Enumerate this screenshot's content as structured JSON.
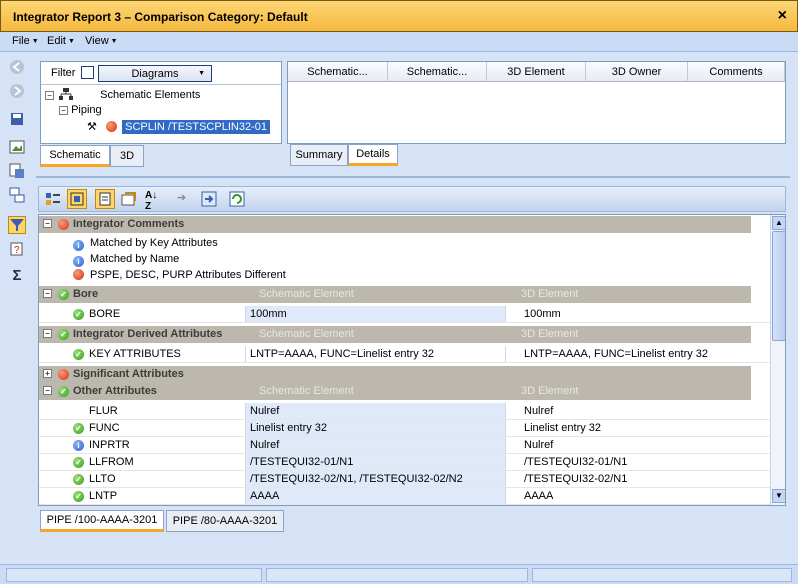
{
  "window": {
    "title": "Integrator Report 3 – Comparison Category: Default",
    "close": "×"
  },
  "menu": [
    {
      "label": "File"
    },
    {
      "label": "Edit"
    },
    {
      "label": "View"
    }
  ],
  "left_toolbar": [
    "back-icon",
    "forward-icon",
    "save-icon",
    "image-icon",
    "export-icon",
    "compare-icon",
    "filter-icon",
    "help-icon",
    "sum-icon"
  ],
  "filter": {
    "label": "Filter",
    "dropdown_value": "Diagrams"
  },
  "tree": {
    "root": "Schematic Elements",
    "child": "Piping",
    "leaf": "SCPLIN /TESTSCPLIN32-01"
  },
  "left_tabs": [
    "Schematic",
    "3D"
  ],
  "columns": [
    "Schematic...",
    "Schematic...",
    "3D Element",
    "3D Owner",
    "Comments"
  ],
  "right_tabs": [
    "Summary",
    "Details"
  ],
  "grid_toolbar": [
    "categorized-icon",
    "filter-icon",
    "properties-icon",
    "events-icon",
    "sort-icon",
    "next-icon",
    "export-icon",
    "refresh-icon"
  ],
  "grid": {
    "integrator_comments": {
      "label": "Integrator Comments",
      "items": [
        "Matched by Key Attributes",
        "Matched by Name",
        "PSPE, DESC, PURP Attributes Different"
      ]
    },
    "headers": {
      "schematic": "Schematic Element",
      "d3": "3D Element"
    },
    "bore": {
      "label": "Bore",
      "row": {
        "name": "BORE",
        "v1": "100mm",
        "v2": "100mm"
      }
    },
    "derived": {
      "label": "Integrator Derived Attributes",
      "row": {
        "name": "KEY ATTRIBUTES",
        "v1": "LNTP=AAAA, FUNC=Linelist entry 32",
        "v2": "LNTP=AAAA, FUNC=Linelist entry 32"
      }
    },
    "significant": {
      "label": "Significant Attributes"
    },
    "other": {
      "label": "Other Attributes",
      "rows": [
        {
          "name": "FLUR",
          "v1": "Nulref",
          "v2": "Nulref",
          "icon": "none"
        },
        {
          "name": "FUNC",
          "v1": "Linelist entry 32",
          "v2": "Linelist entry 32",
          "icon": "green"
        },
        {
          "name": "INPRTR",
          "v1": "Nulref",
          "v2": "Nulref",
          "icon": "blue"
        },
        {
          "name": "LLFROM",
          "v1": "/TESTEQUI32-01/N1",
          "v2": "/TESTEQUI32-01/N1",
          "icon": "green"
        },
        {
          "name": "LLTO",
          "v1": "/TESTEQUI32-02/N1, /TESTEQUI32-02/N2",
          "v2": "/TESTEQUI32-02/N1",
          "icon": "green"
        },
        {
          "name": "LNTP",
          "v1": "AAAA",
          "v2": "AAAA",
          "icon": "green"
        }
      ]
    }
  },
  "bottom_tabs": [
    "PIPE /100-AAAA-3201",
    "PIPE /80-AAAA-3201"
  ]
}
